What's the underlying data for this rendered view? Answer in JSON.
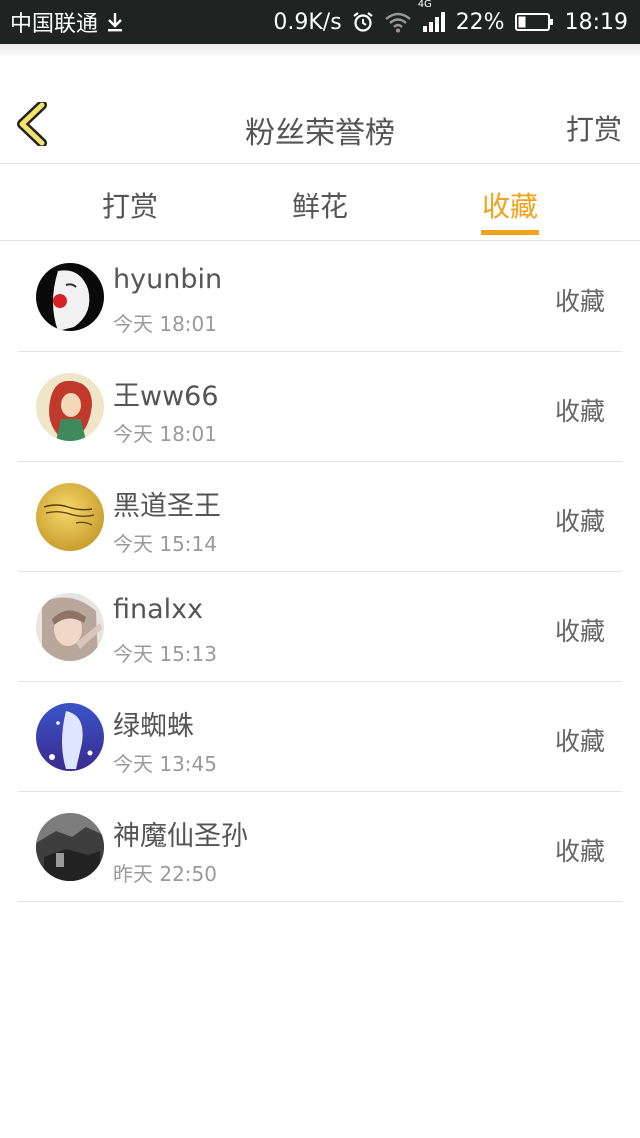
{
  "status_bar": {
    "carrier": "中国联通",
    "download_icon": "download-icon",
    "speed": "0.9K/s",
    "network": "4G",
    "battery": "22%",
    "time": "18:19"
  },
  "header": {
    "back_icon": "chevron-left-icon",
    "title": "粉丝荣誉榜",
    "action": "打赏"
  },
  "tabs": [
    {
      "label": "打赏",
      "active": false
    },
    {
      "label": "鲜花",
      "active": false
    },
    {
      "label": "收藏",
      "active": true
    }
  ],
  "list": [
    {
      "name": "hyunbin",
      "time": "今天 18:01",
      "type": "收藏"
    },
    {
      "name": "王ww66",
      "time": "今天 18:01",
      "type": "收藏"
    },
    {
      "name": "黑道圣王",
      "time": "今天 15:14",
      "type": "收藏"
    },
    {
      "name": "finalxx",
      "time": "今天 15:13",
      "type": "收藏"
    },
    {
      "name": "绿蜘蛛",
      "time": "今天 13:45",
      "type": "收藏"
    },
    {
      "name": "神魔仙圣孙",
      "time": "昨天 22:50",
      "type": "收藏"
    }
  ],
  "colors": {
    "accent": "#f2a21b",
    "status_bar_bg": "#1f2321",
    "text_primary": "#555555",
    "text_secondary": "#9a9a9a",
    "divider": "#e4e4e4"
  }
}
